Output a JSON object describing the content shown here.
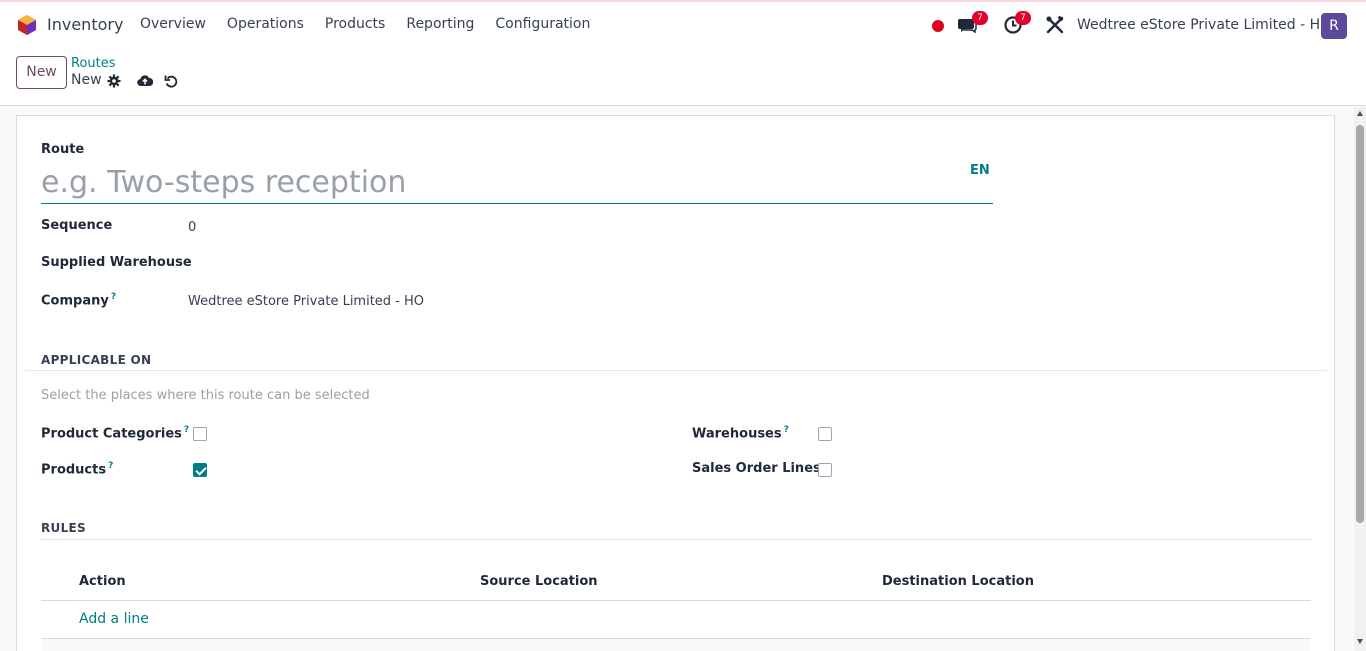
{
  "navbar": {
    "app_name": "Inventory",
    "menu": [
      "Overview",
      "Operations",
      "Products",
      "Reporting",
      "Configuration"
    ],
    "messages_badge": "7",
    "activities_badge": "7",
    "company": "Wedtree eStore Private Limited - HO",
    "avatar_letter": "R",
    "accent_color": "#714b67",
    "link_color": "#017e84"
  },
  "control": {
    "new_label": "New",
    "breadcrumb_parent": "Routes",
    "breadcrumb_current": "New"
  },
  "form": {
    "route_label": "Route",
    "route_placeholder": "e.g. Two-steps reception",
    "lang": "EN",
    "sequence_label": "Sequence",
    "sequence_value": "0",
    "warehouse_label": "Supplied Warehouse",
    "company_label": "Company",
    "company_help": "?",
    "company_value": "Wedtree eStore Private Limited - HO",
    "applicable_title": "APPLICABLE ON",
    "applicable_hint": "Select the places where this route can be selected",
    "product_categories_label": "Product Categories",
    "product_categories_help": "?",
    "product_categories_checked": false,
    "products_label": "Products",
    "products_help": "?",
    "products_checked": true,
    "warehouses_label": "Warehouses",
    "warehouses_help": "?",
    "warehouses_checked": false,
    "sale_lines_label": "Sales Order Lines",
    "sale_lines_checked": false,
    "rules_title": "RULES",
    "rules_columns": [
      "Action",
      "Source Location",
      "Destination Location"
    ],
    "add_line": "Add a line"
  }
}
